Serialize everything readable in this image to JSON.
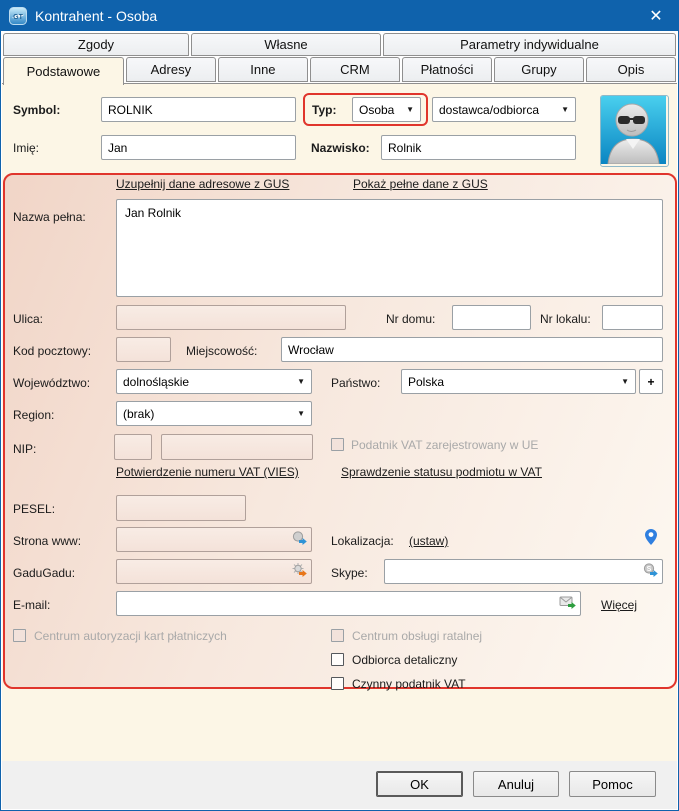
{
  "window": {
    "title": "Kontrahent - Osoba"
  },
  "icons": {
    "close": "✕",
    "dropdown_arrow": "▼"
  },
  "tabs_top": [
    "Zgody",
    "Własne",
    "Parametry indywidualne"
  ],
  "tabs_main": [
    "Podstawowe",
    "Adresy",
    "Inne",
    "CRM",
    "Płatności",
    "Grupy",
    "Opis"
  ],
  "active_tab": "Podstawowe",
  "fields": {
    "symbol": {
      "label": "Symbol:",
      "value": "ROLNIK"
    },
    "typ": {
      "label": "Typ:",
      "value": "Osoba"
    },
    "rodzaj": {
      "value": "dostawca/odbiorca"
    },
    "imie": {
      "label": "Imię:",
      "value": "Jan"
    },
    "nazwisko": {
      "label": "Nazwisko:",
      "value": "Rolnik"
    },
    "nazwa_pelna": {
      "label": "Nazwa pełna:",
      "value": "Jan Rolnik"
    },
    "ulica": {
      "label": "Ulica:",
      "value": ""
    },
    "nr_domu": {
      "label": "Nr domu:",
      "value": ""
    },
    "nr_lokalu": {
      "label": "Nr lokalu:",
      "value": ""
    },
    "kod_pocztowy": {
      "label": "Kod pocztowy:",
      "value": ""
    },
    "miejscowosc": {
      "label": "Miejscowość:",
      "value": "Wrocław"
    },
    "wojewodztwo": {
      "label": "Województwo:",
      "value": "dolnośląskie"
    },
    "panstwo": {
      "label": "Państwo:",
      "value": "Polska",
      "add_button": "+"
    },
    "region": {
      "label": "Region:",
      "value": "(brak)"
    },
    "nip": {
      "label": "NIP:",
      "prefix": "",
      "number": ""
    },
    "pesel": {
      "label": "PESEL:",
      "value": ""
    },
    "strona_www": {
      "label": "Strona www:",
      "value": ""
    },
    "lokalizacja": {
      "label": "Lokalizacja:",
      "link": "(ustaw)"
    },
    "gadugadu": {
      "label": "GaduGadu:",
      "value": ""
    },
    "skype": {
      "label": "Skype:",
      "value": ""
    },
    "email": {
      "label": "E-mail:",
      "value": "",
      "more_link": "Więcej"
    }
  },
  "links": {
    "gus_fill": "Uzupełnij dane adresowe z GUS",
    "gus_show": "Pokaż pełne dane z GUS",
    "vies": "Potwierdzenie numeru VAT (VIES)",
    "vat_status": "Sprawdzenie statusu podmiotu w VAT"
  },
  "checkboxes": {
    "vat_ue": {
      "label": "Podatnik VAT zarejestrowany w UE",
      "checked": false,
      "disabled": true
    },
    "centrum_kart": {
      "label": "Centrum autoryzacji kart płatniczych",
      "checked": false,
      "disabled": true
    },
    "centrum_rat": {
      "label": "Centrum obsługi ratalnej",
      "checked": false,
      "disabled": true
    },
    "odbiorca_det": {
      "label": "Odbiorca detaliczny",
      "checked": false,
      "disabled": false
    },
    "czynny_vat": {
      "label": "Czynny podatnik VAT",
      "checked": false,
      "disabled": false
    }
  },
  "buttons": {
    "ok": "OK",
    "cancel": "Anuluj",
    "help": "Pomoc"
  },
  "colors": {
    "titlebar": "#0f62ac",
    "highlight_red": "#e0352c",
    "content_cream": "#fcf6e6",
    "panel_pink": "#f1d5c7"
  }
}
